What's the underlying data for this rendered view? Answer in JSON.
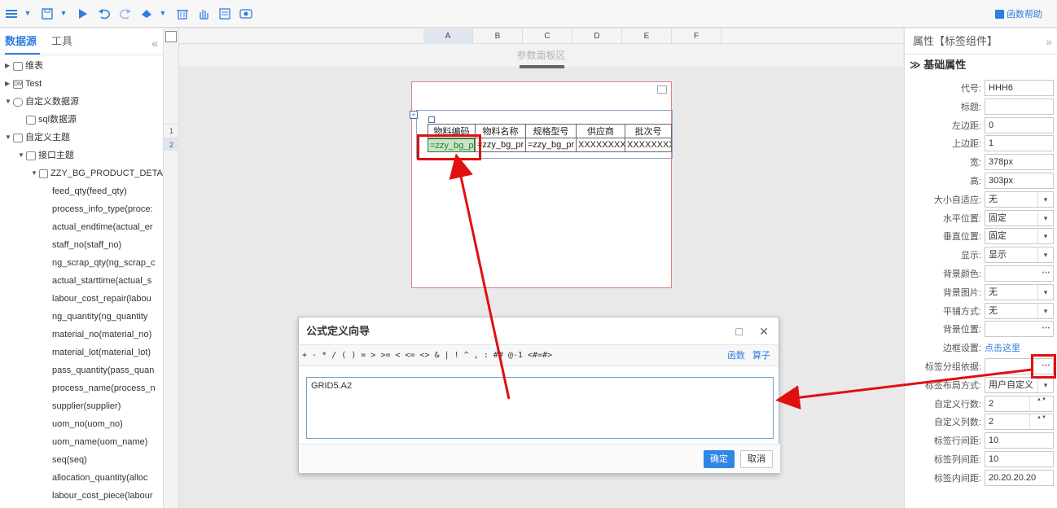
{
  "toolbar": {
    "items": [
      "menu-icon",
      "save-icon",
      "run-icon",
      "undo-icon",
      "redo-icon",
      "paint-icon",
      "delete-icon",
      "hand-icon",
      "form-icon",
      "preview-icon"
    ],
    "help_label": "函数帮助"
  },
  "left_panel": {
    "tabs": [
      "数据源",
      "工具"
    ],
    "collapse": "«",
    "tree": [
      {
        "label": "维表",
        "level": 0,
        "toggle": "▶"
      },
      {
        "label": "Test",
        "level": 0,
        "toggle": "▶",
        "icon_text": "DM"
      },
      {
        "label": "自定义数据源",
        "level": 0,
        "toggle": "▼"
      },
      {
        "label": "sql数据源",
        "level": 1,
        "toggle": ""
      },
      {
        "label": "自定义主题",
        "level": 0,
        "toggle": "▼"
      },
      {
        "label": "接口主题",
        "level": 1,
        "toggle": "▼"
      },
      {
        "label": "ZZY_BG_PRODUCT_DETA",
        "level": 2,
        "toggle": "▼"
      },
      {
        "label": "feed_qty(feed_qty)",
        "level": 3
      },
      {
        "label": "process_info_type(proce:",
        "level": 3
      },
      {
        "label": "actual_endtime(actual_er",
        "level": 3
      },
      {
        "label": "staff_no(staff_no)",
        "level": 3
      },
      {
        "label": "ng_scrap_qty(ng_scrap_c",
        "level": 3
      },
      {
        "label": "actual_starttime(actual_s",
        "level": 3
      },
      {
        "label": "labour_cost_repair(labou",
        "level": 3
      },
      {
        "label": "ng_quantity(ng_quantity",
        "level": 3
      },
      {
        "label": "material_no(material_no)",
        "level": 3
      },
      {
        "label": "material_lot(material_lot)",
        "level": 3
      },
      {
        "label": "pass_quantity(pass_quan",
        "level": 3
      },
      {
        "label": "process_name(process_n",
        "level": 3
      },
      {
        "label": "supplier(supplier)",
        "level": 3
      },
      {
        "label": "uom_no(uom_no)",
        "level": 3
      },
      {
        "label": "uom_name(uom_name)",
        "level": 3
      },
      {
        "label": "seq(seq)",
        "level": 3
      },
      {
        "label": "allocation_quantity(alloc",
        "level": 3
      },
      {
        "label": "labour_cost_piece(labour",
        "level": 3
      }
    ]
  },
  "grid": {
    "columns": [
      "A",
      "B",
      "C",
      "D",
      "E",
      "F"
    ],
    "rows": [
      "1",
      "2"
    ],
    "param_area": "参数面板区"
  },
  "table": {
    "headers": [
      "物料编码",
      "物料名称",
      "规格型号",
      "供应商",
      "批次号"
    ],
    "cells": [
      "=zzy_bg_p",
      "=zzy_bg_pr",
      "=zzy_bg_pr",
      "XXXXXXXX",
      "XXXXXXXX"
    ]
  },
  "properties": {
    "title": "属性【标签组件】",
    "section": "基础属性",
    "rows": [
      {
        "label": "代号:",
        "value": "HHH6",
        "kind": "text"
      },
      {
        "label": "标题:",
        "value": "",
        "kind": "text"
      },
      {
        "label": "左边距:",
        "value": "0",
        "kind": "text"
      },
      {
        "label": "上边距:",
        "value": "1",
        "kind": "text"
      },
      {
        "label": "宽:",
        "value": "378px",
        "kind": "text"
      },
      {
        "label": "高:",
        "value": "303px",
        "kind": "text"
      },
      {
        "label": "大小自适应:",
        "value": "无",
        "kind": "select"
      },
      {
        "label": "水平位置:",
        "value": "固定",
        "kind": "select"
      },
      {
        "label": "垂直位置:",
        "value": "固定",
        "kind": "select"
      },
      {
        "label": "显示:",
        "value": "显示",
        "kind": "select"
      },
      {
        "label": "背景颜色:",
        "value": "",
        "kind": "dots"
      },
      {
        "label": "背景图片:",
        "value": "无",
        "kind": "select"
      },
      {
        "label": "平铺方式:",
        "value": "无",
        "kind": "select"
      },
      {
        "label": "背景位置:",
        "value": "",
        "kind": "dots"
      },
      {
        "label": "边框设置:",
        "value": "点击这里",
        "kind": "link"
      },
      {
        "label": "标签分组依据:",
        "value": "",
        "kind": "dots"
      },
      {
        "label": "标签布局方式:",
        "value": "用户自定义",
        "kind": "select"
      },
      {
        "label": "自定义行数:",
        "value": "2",
        "kind": "spin"
      },
      {
        "label": "自定义列数:",
        "value": "2",
        "kind": "spin"
      },
      {
        "label": "标签行间距:",
        "value": "10",
        "kind": "text"
      },
      {
        "label": "标签列间距:",
        "value": "10",
        "kind": "text"
      },
      {
        "label": "标签内间距:",
        "value": "20.20.20.20",
        "kind": "text"
      }
    ]
  },
  "dialog": {
    "title": "公式定义向导",
    "operators": "+ - * / ( ) = > >= < <= <> & | ! ^ , : ## @-1 <#=#>",
    "func_link": "函数",
    "operator_link": "算子",
    "formula": "GRID5.A2",
    "ok": "确定",
    "cancel": "取消",
    "maximize": "□",
    "close": "✕"
  },
  "colors": {
    "accent": "#2f7de1",
    "highlight": "#e01010",
    "selected_cell": "#c7e4c7"
  }
}
